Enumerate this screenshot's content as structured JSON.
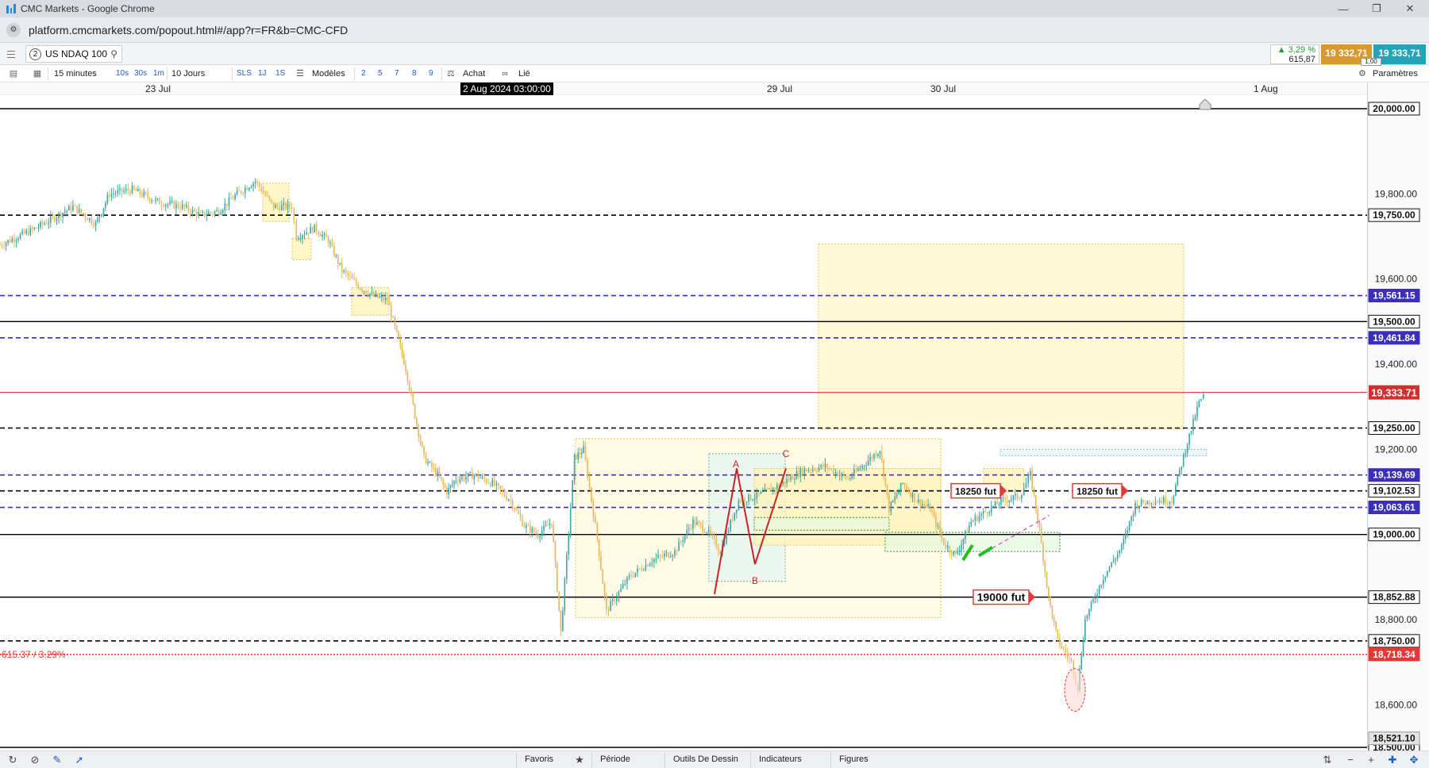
{
  "browser": {
    "window_title": "CMC Markets - Google Chrome",
    "url": "platform.cmcmarkets.com/popout.html#/app?r=FR&b=CMC-CFD"
  },
  "header": {
    "tab_number": "2",
    "symbol": "US NDAQ 100",
    "change_pct": "▲ 3,29 %",
    "change_abs": "615,87",
    "sell_price": "19 332,71",
    "buy_price": "19 333,71",
    "spread": "1,00"
  },
  "toolbar": {
    "timeframe": "15 minutes",
    "quick_intervals": [
      "10s",
      "30s",
      "1m"
    ],
    "range": "10 Jours",
    "chart_types": [
      "SLS",
      "1J",
      "1S"
    ],
    "templates_label": "Modèles",
    "presets": [
      "2",
      "5",
      "7",
      "8",
      "9"
    ],
    "side_label": "Achat",
    "linked_label": "Lié",
    "settings_label": "Paramètres"
  },
  "time_axis": {
    "labels": [
      "23 Jul",
      "29 Jul",
      "30 Jul",
      "1 Aug"
    ],
    "cursor_label": "2 Aug 2024 03:00:00"
  },
  "bottom_bar": {
    "tabs": [
      "Favoris",
      "Période",
      "Outils De Dessin",
      "Indicateurs",
      "Figures"
    ]
  },
  "chart_data": {
    "type": "candlestick",
    "symbol": "US NDAQ 100",
    "interval": "15 minutes",
    "ylim": [
      18500,
      20020
    ],
    "y_ticks": [
      18600,
      18800,
      19200,
      19400,
      19600,
      19800
    ],
    "y_tick_labels": [
      "18,600.00",
      "18,800.00",
      "19,200.00",
      "19,400.00",
      "19,600.00",
      "19,800.00"
    ],
    "grid": false,
    "current_price": 19333.71,
    "current_price_label": "19,333.71",
    "change_annotation": "615.37 / 3.29%",
    "last_low_label": "18,521.10",
    "last_low": 18521.1,
    "horizontal_lines": [
      {
        "value": 20000,
        "label": "20,000.00",
        "style": "solid",
        "color": "#000000"
      },
      {
        "value": 19750,
        "label": "19,750.00",
        "style": "dashed",
        "color": "#000000"
      },
      {
        "value": 19561.15,
        "label": "19,561.15",
        "style": "dashed",
        "color": "#2e2ec4"
      },
      {
        "value": 19500,
        "label": "19,500.00",
        "style": "solid",
        "color": "#000000"
      },
      {
        "value": 19461.84,
        "label": "19,461.84",
        "style": "dashed",
        "color": "#2e2ec4"
      },
      {
        "value": 19250,
        "label": "19,250.00",
        "style": "dashed",
        "color": "#000000"
      },
      {
        "value": 19139.69,
        "label": "19,139.69",
        "style": "dashed",
        "color": "#4b2bb0"
      },
      {
        "value": 19102.53,
        "label": "19,102.53",
        "style": "dashed",
        "color": "#000000"
      },
      {
        "value": 19063.61,
        "label": "19,063.61",
        "style": "dashed",
        "color": "#4b2bb0"
      },
      {
        "value": 19000,
        "label": "19,000.00",
        "style": "solid",
        "color": "#000000"
      },
      {
        "value": 18852.88,
        "label": "18,852.88",
        "style": "solid",
        "color": "#000000"
      },
      {
        "value": 18750,
        "label": "18,750.00",
        "style": "dashed",
        "color": "#000000"
      },
      {
        "value": 18718.34,
        "label": "18,718.34",
        "style": "dotted",
        "color": "#e53935"
      },
      {
        "value": 18500,
        "label": "18,500.00",
        "style": "solid",
        "color": "#000000"
      }
    ],
    "price_path": [
      [
        0,
        19680
      ],
      [
        40,
        19720
      ],
      [
        80,
        19770
      ],
      [
        105,
        19730
      ],
      [
        120,
        19800
      ],
      [
        145,
        19810
      ],
      [
        175,
        19780
      ],
      [
        200,
        19770
      ],
      [
        220,
        19750
      ],
      [
        240,
        19760
      ],
      [
        260,
        19800
      ],
      [
        280,
        19830
      ],
      [
        300,
        19770
      ],
      [
        320,
        19770
      ],
      [
        325,
        19700
      ],
      [
        345,
        19720
      ],
      [
        360,
        19690
      ],
      [
        375,
        19620
      ],
      [
        395,
        19580
      ],
      [
        410,
        19560
      ],
      [
        425,
        19550
      ],
      [
        435,
        19470
      ],
      [
        445,
        19390
      ],
      [
        455,
        19280
      ],
      [
        465,
        19180
      ],
      [
        480,
        19140
      ],
      [
        490,
        19100
      ],
      [
        500,
        19130
      ],
      [
        520,
        19140
      ],
      [
        540,
        19120
      ],
      [
        560,
        19080
      ],
      [
        575,
        19020
      ],
      [
        590,
        19000
      ],
      [
        605,
        19030
      ],
      [
        615,
        18770
      ],
      [
        630,
        19180
      ],
      [
        640,
        19200
      ],
      [
        655,
        18990
      ],
      [
        665,
        18820
      ],
      [
        690,
        18900
      ],
      [
        715,
        18940
      ],
      [
        740,
        18960
      ],
      [
        760,
        19030
      ],
      [
        775,
        19010
      ],
      [
        790,
        18960
      ],
      [
        810,
        19080
      ],
      [
        830,
        19090
      ],
      [
        850,
        19110
      ],
      [
        880,
        19150
      ],
      [
        905,
        19160
      ],
      [
        930,
        19130
      ],
      [
        950,
        19170
      ],
      [
        965,
        19200
      ],
      [
        975,
        19060
      ],
      [
        990,
        19120
      ],
      [
        1005,
        19080
      ],
      [
        1020,
        19060
      ],
      [
        1035,
        18980
      ],
      [
        1048,
        18950
      ],
      [
        1065,
        19030
      ],
      [
        1085,
        19060
      ],
      [
        1100,
        19080
      ],
      [
        1118,
        19090
      ],
      [
        1130,
        19140
      ],
      [
        1140,
        19010
      ],
      [
        1150,
        18850
      ],
      [
        1160,
        18750
      ],
      [
        1175,
        18700
      ],
      [
        1182,
        18640
      ],
      [
        1190,
        18800
      ],
      [
        1210,
        18900
      ],
      [
        1230,
        18970
      ],
      [
        1245,
        19070
      ],
      [
        1265,
        19080
      ],
      [
        1285,
        19080
      ],
      [
        1300,
        19200
      ],
      [
        1315,
        19310
      ],
      [
        1322,
        19330
      ]
    ],
    "patterns": [
      {
        "type": "abc",
        "labels": [
          "A",
          "B",
          "C"
        ]
      }
    ],
    "order_tags": [
      {
        "label": "18250 fut"
      },
      {
        "label": "18250 fut"
      },
      {
        "label": "19000 fut"
      }
    ],
    "colors": {
      "candle_up": "#3aa6a6",
      "candle_down": "#e7b75a",
      "current_line": "#d32f2f",
      "zone_fill": "#fff6c9",
      "zone_border": "#e2c34a",
      "abc": "#cc2222"
    }
  }
}
